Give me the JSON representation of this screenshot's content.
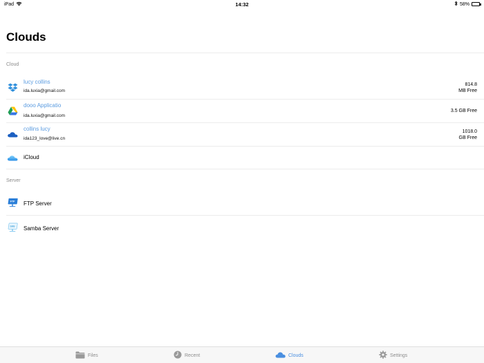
{
  "status_bar": {
    "device": "iPad",
    "time": "14:32",
    "battery": "58%",
    "battery_level": 0.58
  },
  "page": {
    "title": "Clouds"
  },
  "sections": {
    "cloud": {
      "header": "Cloud",
      "items": [
        {
          "name": "lucy collins",
          "email": "ida.luxia@gmail.com",
          "free_line1": "814.8",
          "free_line2": "MB Free",
          "icon": "dropbox-icon"
        },
        {
          "name": "dooo Applicatio",
          "email": "ida.luxia@gmail.com",
          "free_line1": "3.5 GB Free",
          "free_line2": "",
          "icon": "google-drive-icon"
        },
        {
          "name": "collins lucy",
          "email": "ida123_love@live.cn",
          "free_line1": "1018.0",
          "free_line2": "GB Free",
          "icon": "onedrive-icon"
        },
        {
          "name": "iCloud",
          "icon": "icloud-icon"
        }
      ]
    },
    "server": {
      "header": "Server",
      "items": [
        {
          "name": "FTP Server",
          "icon": "ftp-server-icon",
          "badge": "FTP"
        },
        {
          "name": "Samba Server",
          "icon": "samba-server-icon",
          "badge": "SMB"
        }
      ]
    }
  },
  "tab_bar": {
    "tabs": [
      {
        "label": "Files",
        "icon": "folder-icon",
        "active": false
      },
      {
        "label": "Recent",
        "icon": "clock-icon",
        "active": false
      },
      {
        "label": "Clouds",
        "icon": "cloud-icon",
        "active": true
      },
      {
        "label": "Settings",
        "icon": "gear-icon",
        "active": false
      }
    ]
  },
  "colors": {
    "accent": "#4a8fe0",
    "link": "#5a9be0",
    "divider": "#ececec",
    "muted": "#8e8e8e"
  }
}
